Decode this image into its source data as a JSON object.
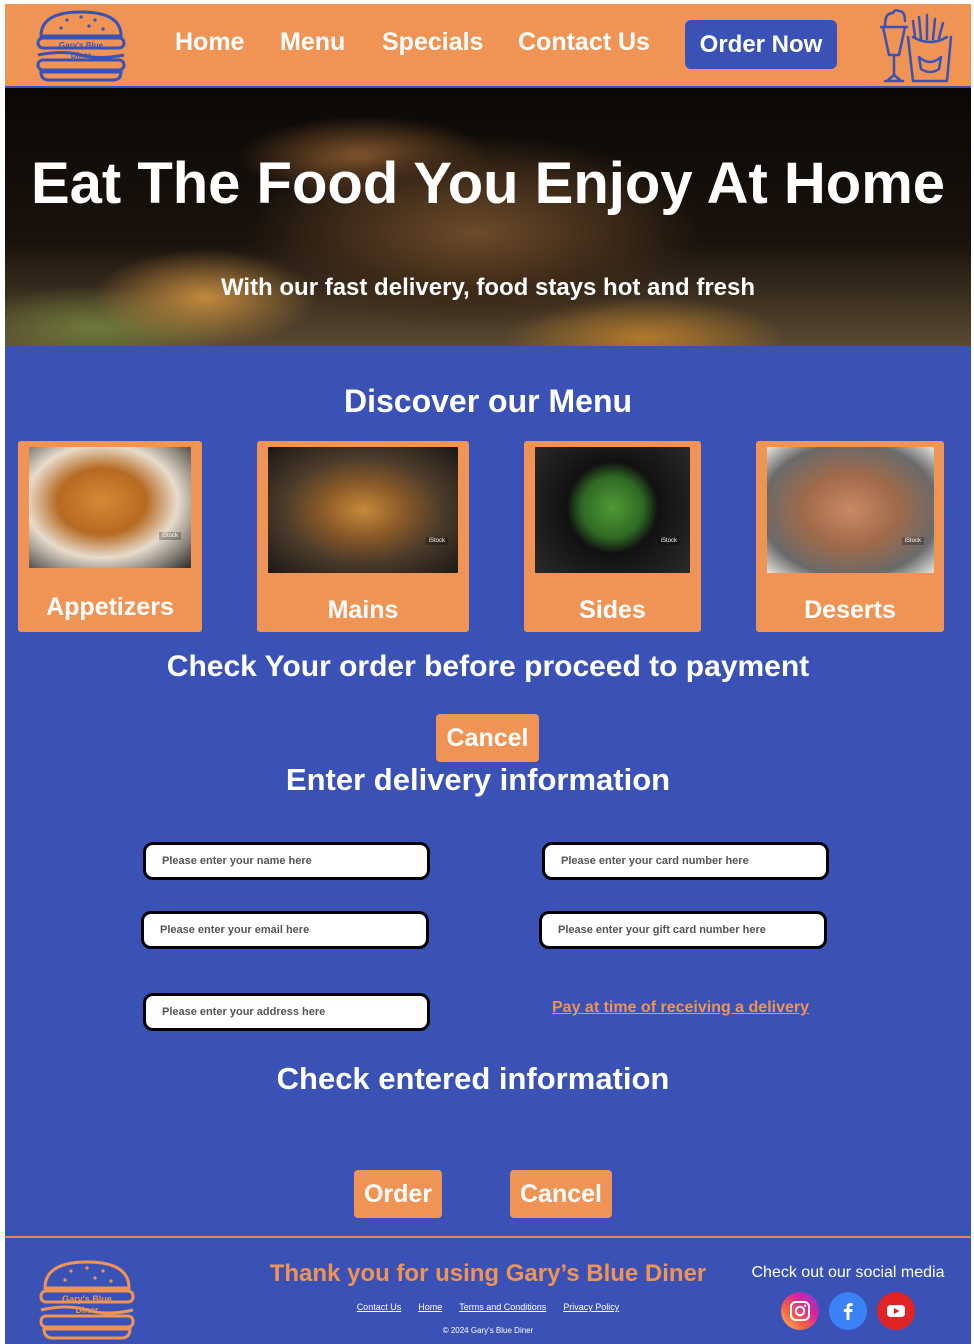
{
  "header": {
    "logo_text_line1": "Gary's Blue",
    "logo_text_line2": "Diner",
    "nav": [
      "Home",
      "Menu",
      "Specials",
      "Contact Us"
    ],
    "order_now": "Order Now"
  },
  "hero": {
    "title": "Eat The Food You Enjoy At Home",
    "subtitle": "With our fast delivery, food stays hot and fresh"
  },
  "menu": {
    "title": "Discover our Menu",
    "cards": [
      {
        "label": "Appetizers",
        "watermark": "iStock"
      },
      {
        "label": "Mains",
        "watermark": "iStock"
      },
      {
        "label": "Sides",
        "watermark": "iStock"
      },
      {
        "label": "Deserts",
        "watermark": "iStock"
      }
    ]
  },
  "order": {
    "check_title": "Check Your order before proceed to payment",
    "cancel_label": "Cancel"
  },
  "delivery": {
    "title": "Enter delivery information",
    "name_placeholder": "Please enter your name here",
    "email_placeholder": "Please enter your email here",
    "address_placeholder": "Please enter your address here",
    "card_placeholder": "Please enter your card number here",
    "gift_placeholder": "Please enter your gift card number here",
    "pay_on_delivery": "Pay at time of receiving a delivery"
  },
  "confirm": {
    "title": "Check entered information",
    "order_label": "Order",
    "cancel_label": "Cancel"
  },
  "footer": {
    "thanks": "Thank you for using Gary’s Blue Diner",
    "links": [
      "Contact Us",
      "Home",
      "Terms and Conditions",
      "Privacy Policy"
    ],
    "copyright": "© 2024 Gary's Blue Diner",
    "social_text": "Check out our social media",
    "logo_text_line1": "Gary's Blue",
    "logo_text_line2": "Diner"
  },
  "colors": {
    "primary_blue": "#3a52b5",
    "accent_orange": "#f09455",
    "instagram": "#d6249f",
    "facebook": "#3b82f6",
    "youtube": "#e32424"
  }
}
